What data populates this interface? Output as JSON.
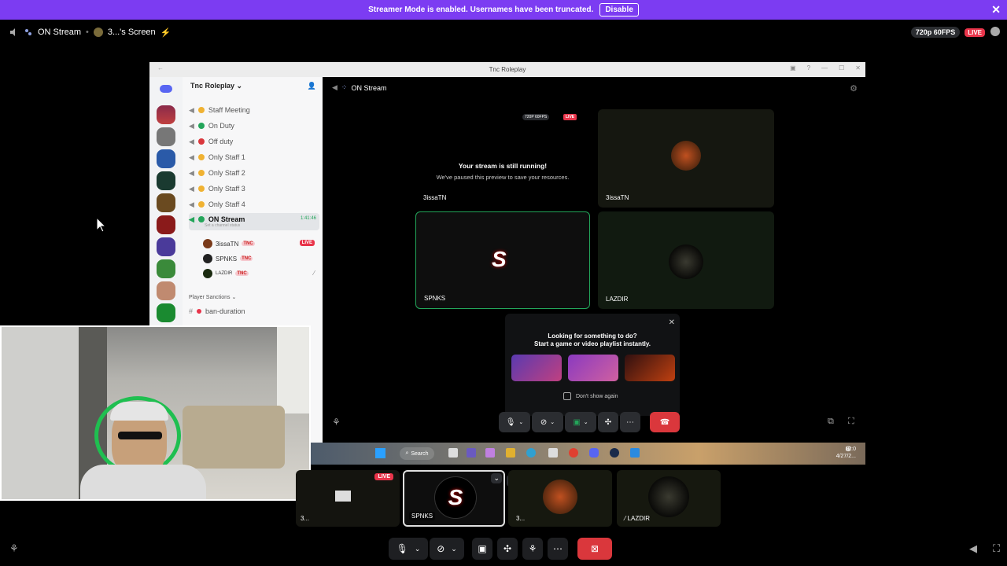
{
  "banner": {
    "message": "Streamer Mode is enabled. Usernames have been truncated.",
    "disable_label": "Disable",
    "close_icon": "close-icon"
  },
  "header": {
    "channel": "ON Stream",
    "screen": "3...'s Screen",
    "quality": "720p 60FPS",
    "live": "LIVE"
  },
  "inner": {
    "title": "Tnc Roleplay",
    "server_name": "Tnc Roleplay",
    "channels": [
      {
        "label": "Staff Meeting",
        "dot": "#f0b232"
      },
      {
        "label": "On Duty",
        "dot": "#23a55a"
      },
      {
        "label": "Off duty",
        "dot": "#da373c"
      },
      {
        "label": "Only Staff 1",
        "dot": "#f0b232"
      },
      {
        "label": "Only Staff 2",
        "dot": "#f0b232"
      },
      {
        "label": "Only Staff 3",
        "dot": "#f0b232"
      },
      {
        "label": "Only Staff 4",
        "dot": "#f0b232"
      },
      {
        "label": "ON Stream",
        "dot": "#23a55a"
      }
    ],
    "active_channel_time": "1:41:46",
    "channel_status": "Set a channel status",
    "members": [
      {
        "name": "3issaTN",
        "tag": "TNC",
        "badge": "LIVE"
      },
      {
        "name": "SPNKS",
        "tag": "TNC",
        "badge": ""
      },
      {
        "name": "LAZDIR",
        "tag": "TNC",
        "badge": ""
      }
    ],
    "category": "Player Sanctions",
    "text_channel": "ban-duration",
    "call_channel": "ON Stream",
    "paused_quality": "720P 60FPS",
    "paused_live": "LIVE",
    "paused_title": "Your stream is still running!",
    "paused_sub": "We've paused this preview to save your resources.",
    "tiles": [
      {
        "label": "3issaTN"
      },
      {
        "label": "3issaTN"
      },
      {
        "label": "SPNKS"
      },
      {
        "label": "LAZDIR"
      }
    ],
    "activity_line1": "Looking for something to do?",
    "activity_line2": "Start a game or video playlist instantly.",
    "dont_show": "Don't show again",
    "taskbar_search": "Search",
    "taskbar_time": "12:0",
    "taskbar_date": "4/27/2..."
  },
  "bottom_tiles": [
    {
      "label": "3...",
      "badge": "LIVE"
    },
    {
      "label": "SPNKS"
    },
    {
      "label": "3..."
    },
    {
      "label": "LAZDIR"
    }
  ],
  "colors": {
    "banner": "#7c3cf2",
    "live": "#e8344a",
    "hangup": "#da373c",
    "accent_green": "#23a55a"
  }
}
